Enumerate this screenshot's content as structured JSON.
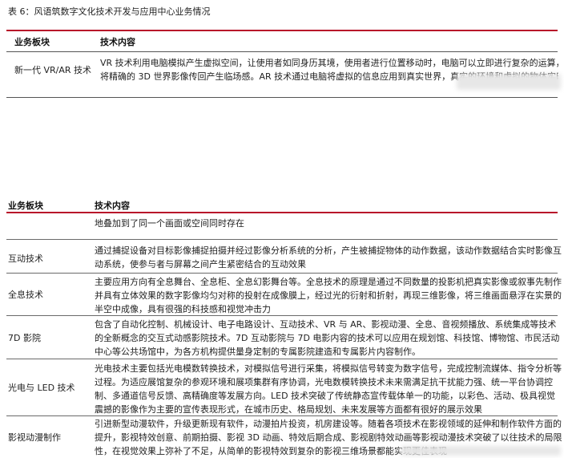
{
  "table_caption": "表 6：风语筑数字文化技术开发与应用中心业务情况",
  "top_table": {
    "col1_header": "业务板块",
    "col2_header": "技术内容",
    "row": {
      "segment": "新一代 VR/AR 技术",
      "line1": "VR 技术利用电脑模拟产生虚拟空间，让使用者如同身历其境，使用者进行位置移动时，电脑可以立即进行复杂的运算，",
      "line2": "将精确的 3D 世界影像传回产生临场感。AR 技术通过电脑将虚拟的信息应用到真实世界，真实的环境和虚拟的物体实时"
    }
  },
  "main_table": {
    "col1_header": "业务板块",
    "col2_header": "技术内容",
    "continuation_text": "地叠加到了同一个画面或空间同时存在",
    "rows": [
      {
        "segment": "互动技术",
        "content": "通过捕捉设备对目标影像捕捉拍摄并经过影像分析系统的分析，产生被捕捉物体的动作数据，该动作数据结合实时影像互动系统，使参与者与屏幕之间产生紧密结合的互动效果"
      },
      {
        "segment": "全息技术",
        "content": "主要应用方向有全息舞台、全息柜、全息幻影舞台等。全息技术的原理是通过不同数量的投影机把真实影像或叙事先制作并具有立体效果的数字影像均匀对称的投射在成像膜上，经过光的衍射和折射，再现三维影像，将三维画面悬浮在实景的半空中成像，具有很强的科技感和视觉冲击力"
      },
      {
        "segment": "7D 影院",
        "content": "包含了自动化控制、机械设计、电子电路设计、互动技术、VR 与 AR、影视动漫、全息、音视频播放、系统集成等技术的全新概念的交互式动感影院技术。7D 互动影院与 7D 电影内容的技术可以应用在规划馆、科技馆、博物馆、市民活动中心等公共场馆中，为各方机构提供量身定制的专属影院建造和专属影片内容制作。"
      },
      {
        "segment": "光电与 LED 技术",
        "content": "光电技术主要包括光电模数转换技术，对模拟信号进行采集，将模拟信号转变为数字信号，完成控制流媒体、指令分析等过程。为适应展馆复杂的参观环境和展项集群有序协调，光电数模转换技术未来需满足抗干扰能力强、统一平台协调控制、多通道信号反馈、高精确度等发展方向。LED 技术突破了传统静态宣传载体单一的功能，以彩色、活动、极具视觉震撼的影像作为主要的宣传表现形式，在城市历史、格局规划、未来发展等方面都有很好的展示效果"
      },
      {
        "segment": "影视动漫制作",
        "content": "引进新型动漫软件，升级更新现有软件，动漫拍片投资，机房建设等。随着各项技术在影视领域的延伸和制作软件方面的提升，影视特效创意、前期拍摄、影视 3D 动画、特效后期合成、影视剧特效动画等影视动漫技术突破了以往技术的局限性，在视觉效果上弥补了不足，从简单的影视特效到复杂的影视三维场景都能实现更佳表现"
      }
    ]
  }
}
